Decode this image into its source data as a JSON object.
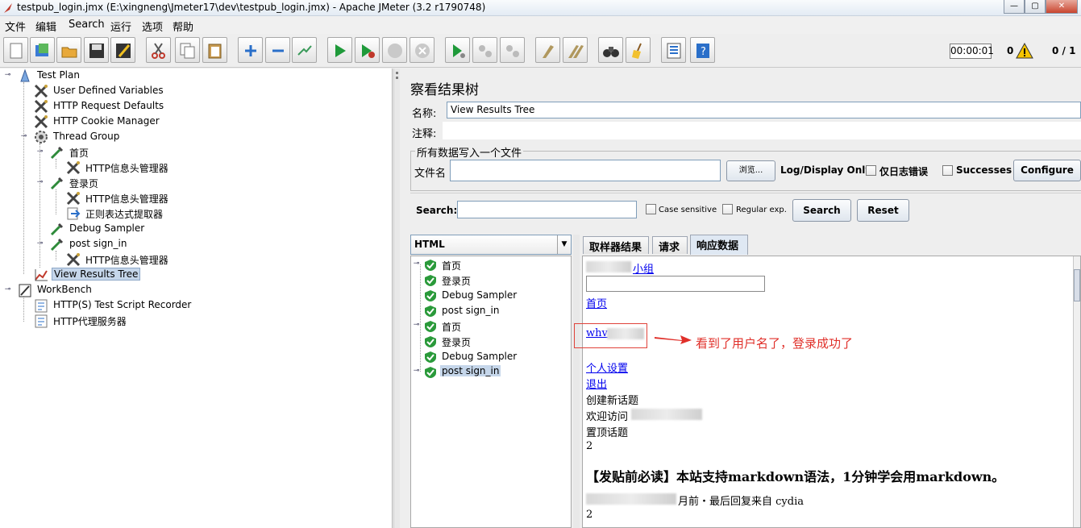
{
  "window": {
    "title": "testpub_login.jmx (E:\\xingneng\\Jmeter17\\dev\\testpub_login.jmx) - Apache JMeter (3.2 r1790748)",
    "controls": [
      "—",
      "▢",
      "✕"
    ]
  },
  "menu": [
    "文件",
    "编辑",
    "Search",
    "运行",
    "选项",
    "帮助"
  ],
  "toolbar": {
    "icons": [
      "new-icon",
      "templates-icon",
      "open-icon",
      "save-icon",
      "save-as-icon",
      "cut-icon",
      "copy-icon",
      "paste-icon",
      "expand-icon",
      "collapse-icon",
      "toggle-icon",
      "start-icon",
      "start-no-pause-icon",
      "stop-icon",
      "shutdown-icon",
      "remote-start-icon",
      "remote-stop-icon",
      "remote-shutdown-icon",
      "clear-icon",
      "clear-all-icon",
      "search-icon",
      "reset-search-icon",
      "function-helper-icon",
      "help-icon"
    ],
    "timer": "00:00:01",
    "error_count": "0",
    "threads": "0 / 1"
  },
  "tree": [
    {
      "label": "Test Plan",
      "icon": "test-plan-icon",
      "depth": 0,
      "expanded": true
    },
    {
      "label": "User Defined Variables",
      "icon": "config-icon",
      "depth": 1
    },
    {
      "label": "HTTP Request Defaults",
      "icon": "config-icon",
      "depth": 1
    },
    {
      "label": "HTTP Cookie Manager",
      "icon": "config-icon",
      "depth": 1
    },
    {
      "label": "Thread Group",
      "icon": "thread-group-icon",
      "depth": 1,
      "expanded": true
    },
    {
      "label": "首页",
      "icon": "sampler-icon",
      "depth": 2,
      "expanded": true
    },
    {
      "label": "HTTP信息头管理器",
      "icon": "config-icon",
      "depth": 3
    },
    {
      "label": "登录页",
      "icon": "sampler-icon",
      "depth": 2,
      "expanded": true
    },
    {
      "label": "HTTP信息头管理器",
      "icon": "config-icon",
      "depth": 3
    },
    {
      "label": "正则表达式提取器",
      "icon": "extractor-icon",
      "depth": 3
    },
    {
      "label": "Debug Sampler",
      "icon": "sampler-icon",
      "depth": 2
    },
    {
      "label": "post sign_in",
      "icon": "sampler-icon",
      "depth": 2,
      "expanded": true
    },
    {
      "label": "HTTP信息头管理器",
      "icon": "config-icon",
      "depth": 3
    },
    {
      "label": "View Results Tree",
      "icon": "listener-icon",
      "depth": 2,
      "selected": true
    },
    {
      "label": "WorkBench",
      "icon": "workbench-icon",
      "depth": 0,
      "expanded": true
    },
    {
      "label": "HTTP(S) Test Script Recorder",
      "icon": "recorder-icon",
      "depth": 1
    },
    {
      "label": "HTTP代理服务器",
      "icon": "recorder-icon",
      "depth": 1
    }
  ],
  "panel": {
    "title": "察看结果树",
    "name_label": "名称:",
    "name_value": "View Results Tree",
    "comment_label": "注释:",
    "file_section": "所有数据写入一个文件",
    "file_label": "文件名",
    "browse_label": "浏览...",
    "log_display_label": "Log/Display Only:",
    "errors_only_label": "仅日志错误",
    "successes_label": "Successes",
    "configure_label": "Configure",
    "search_label": "Search:",
    "case_sensitive_label": "Case sensitive",
    "regex_label": "Regular exp.",
    "search_button": "Search",
    "reset_button": "Reset",
    "renderer": "HTML"
  },
  "results": [
    {
      "label": "首页",
      "toggle": true
    },
    {
      "label": "登录页"
    },
    {
      "label": "Debug Sampler"
    },
    {
      "label": "post sign_in"
    },
    {
      "label": "首页",
      "toggle": true
    },
    {
      "label": "登录页"
    },
    {
      "label": "Debug Sampler"
    },
    {
      "label": "post sign_in",
      "toggle": true,
      "selected": true
    }
  ],
  "tabs": [
    "取样器结果",
    "请求",
    "响应数据"
  ],
  "response": {
    "group_link_suffix": "小组",
    "home_link": "首页",
    "username": "whv",
    "annotation": "看到了用户名了，登录成功了",
    "settings_link": "个人设置",
    "logout_link": "退出",
    "new_topic": "创建新话题",
    "welcome": "欢迎访问",
    "pinned": "置顶话题",
    "count_1": "2",
    "notice": "【发贴前必读】本站支持markdown语法，1分钟学会用markdown。",
    "meta_suffix": "月前・最后回复来自 cydia",
    "count_2": "2"
  },
  "colors": {
    "accent_red": "#e0302a",
    "link": "#0000ee",
    "selection": "#c5d6ea"
  }
}
